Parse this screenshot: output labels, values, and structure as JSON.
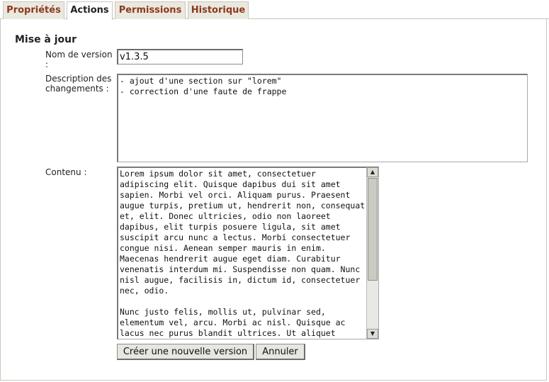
{
  "tabs": [
    {
      "label": "Propriétés",
      "active": false
    },
    {
      "label": "Actions",
      "active": true
    },
    {
      "label": "Permissions",
      "active": false
    },
    {
      "label": "Historique",
      "active": false
    }
  ],
  "section": {
    "title": "Mise à jour"
  },
  "form": {
    "version_label": "Nom de version :",
    "version_value": "v1.3.5",
    "description_label": "Description des changements :",
    "description_value": "- ajout d'une section sur \"lorem\"\n- correction d'une faute de frappe",
    "content_label": "Contenu :",
    "content_value": "Lorem ipsum dolor sit amet, consectetuer adipiscing elit. Quisque dapibus dui sit amet sapien. Morbi vel orci. Aliquam purus. Praesent augue turpis, pretium ut, hendrerit non, consequat et, elit. Donec ultricies, odio non laoreet dapibus, elit turpis posuere ligula, sit amet suscipit arcu nunc a lectus. Morbi consectetuer congue nisi. Aenean semper mauris in enim. Maecenas hendrerit augue eget diam. Curabitur venenatis interdum mi. Suspendisse non quam. Nunc nisl augue, facilisis in, dictum id, consectetuer nec, odio.\n\nNunc justo felis, mollis ut, pulvinar sed, elementum vel, arcu. Morbi ac nisl. Quisque ac lacus nec purus blandit ultrices. Ut aliquet"
  },
  "buttons": {
    "create_label": "Créer une nouvelle version",
    "cancel_label": "Annuler"
  },
  "colors": {
    "tab_text": "#8b3a1b",
    "tab_bg": "#ebe8e0",
    "border": "#c9c6bd"
  },
  "icons": {
    "scroll_up": "arrow-up-icon",
    "scroll_down": "arrow-down-icon"
  }
}
